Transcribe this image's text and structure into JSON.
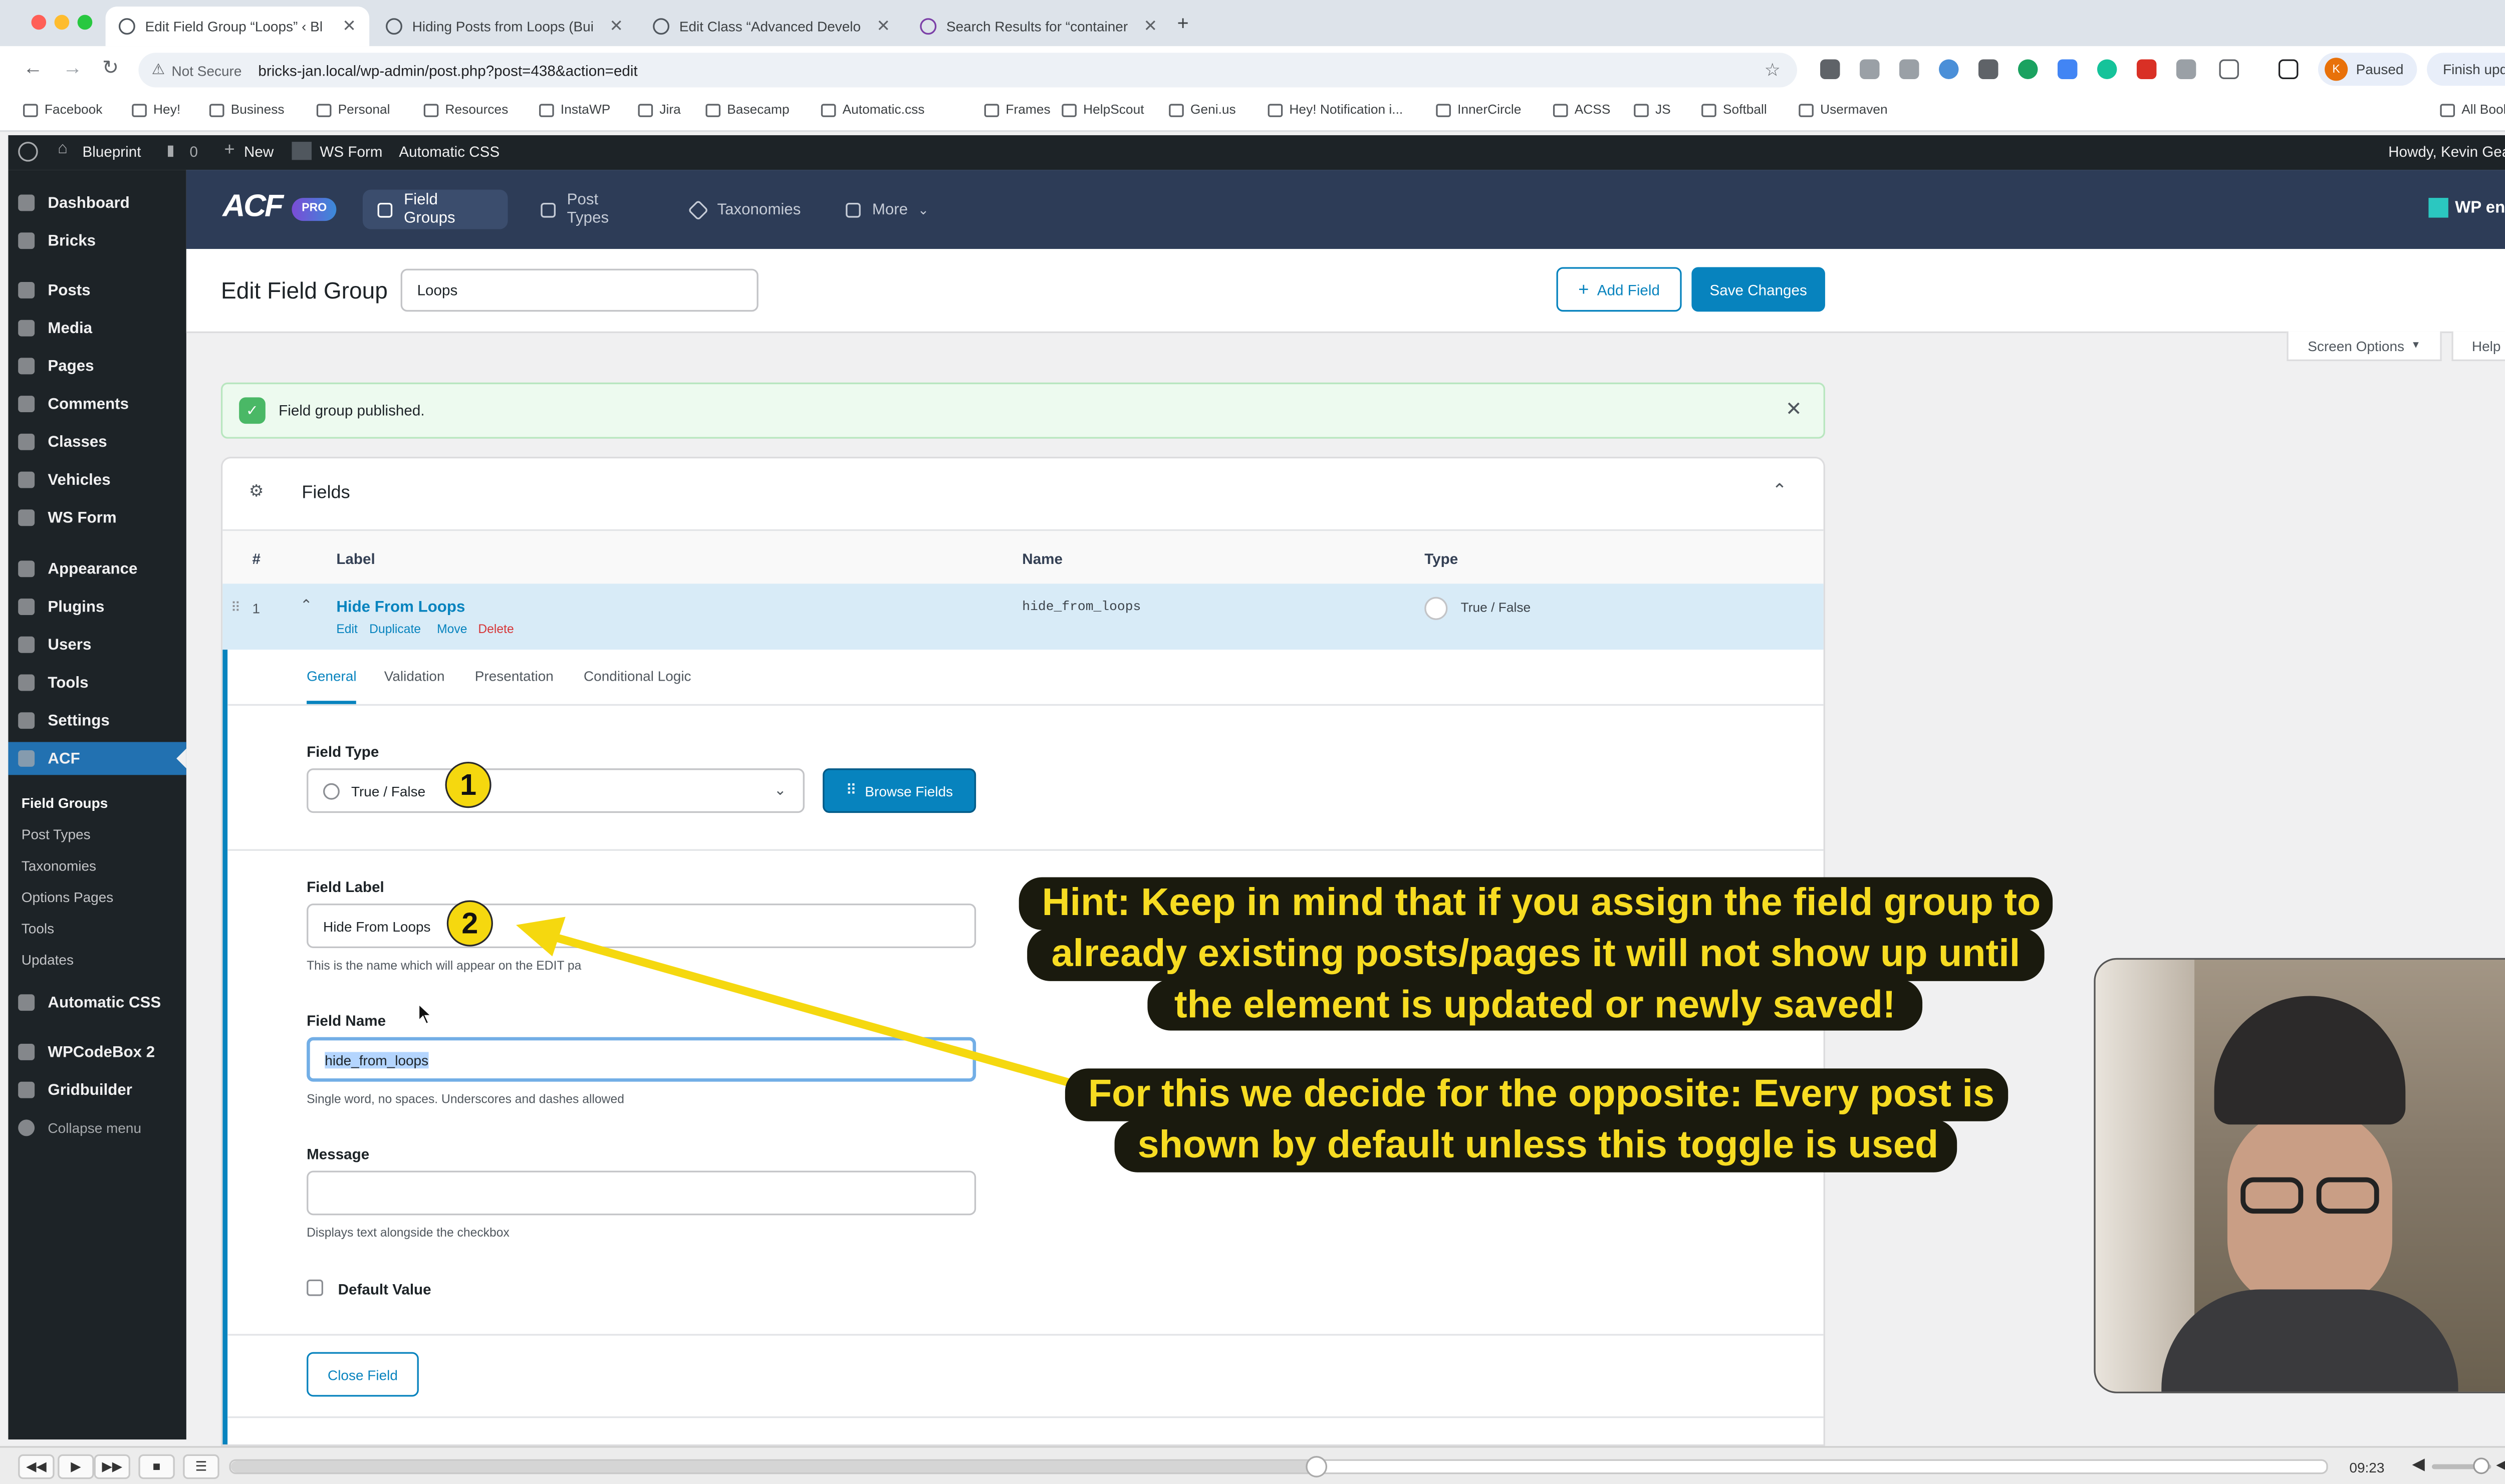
{
  "browser": {
    "tabs": [
      {
        "title": "Edit Field Group “Loops” ‹ Bl"
      },
      {
        "title": "Hiding Posts from Loops (Bui"
      },
      {
        "title": "Edit Class “Advanced Develo"
      },
      {
        "title": "Search Results for “container"
      }
    ],
    "new_tab": "+",
    "security_label": "Not Secure",
    "url": "bricks-jan.local/wp-admin/post.php?post=438&action=edit",
    "profile_initial": "K",
    "profile_status": "Paused",
    "finish_update": "Finish update",
    "bookmarks": [
      "Facebook",
      "Hey!",
      "Business",
      "Personal",
      "Resources",
      "InstaWP",
      "Jira",
      "Basecamp",
      "Automatic.css",
      "Frames",
      "HelpScout",
      "Geni.us",
      "Hey! Notification i...",
      "InnerCircle",
      "ACSS",
      "JS",
      "Softball",
      "Usermaven"
    ],
    "all_bookmarks": "All Bookmarks"
  },
  "admin_bar": {
    "site_name": "Blueprint",
    "comments": "0",
    "new": "New",
    "ws_form": "WS Form",
    "automatic_css": "Automatic CSS",
    "howdy": "Howdy, Kevin Geary"
  },
  "sidebar": {
    "items": [
      "Dashboard",
      "Bricks",
      "Posts",
      "Media",
      "Pages",
      "Comments",
      "Classes",
      "Vehicles",
      "WS Form",
      "Appearance",
      "Plugins",
      "Users",
      "Tools",
      "Settings",
      "ACF"
    ],
    "acf_sub": [
      "Field Groups",
      "Post Types",
      "Taxonomies",
      "Options Pages",
      "Tools",
      "Updates"
    ],
    "lower": [
      "Automatic CSS",
      "WPCodeBox 2",
      "Gridbuilder"
    ],
    "collapse": "Collapse menu"
  },
  "acf_nav": {
    "logo": "ACF",
    "pro": "PRO",
    "tabs": [
      "Field Groups",
      "Post Types",
      "Taxonomies",
      "More"
    ],
    "host": "WP engine"
  },
  "header": {
    "title": "Edit Field Group",
    "group_name": "Loops",
    "add_field": "Add Field",
    "save_changes": "Save Changes",
    "screen_options": "Screen Options",
    "help": "Help"
  },
  "notice": {
    "text": "Field group published."
  },
  "fields": {
    "title": "Fields",
    "columns": [
      "#",
      "Label",
      "Name",
      "Type"
    ],
    "row": {
      "num": "1",
      "label": "Hide From Loops",
      "actions": [
        "Edit",
        "Duplicate",
        "Move",
        "Delete"
      ],
      "name": "hide_from_loops",
      "type": "True / False"
    },
    "tabs": [
      "General",
      "Validation",
      "Presentation",
      "Conditional Logic"
    ],
    "field_type_label": "Field Type",
    "field_type_value": "True / False",
    "browse_fields": "Browse Fields",
    "field_label_label": "Field Label",
    "field_label_value": "Hide From Loops",
    "field_label_help": "This is the name which will appear on the EDIT pa",
    "field_name_label": "Field Name",
    "field_name_value": "hide_from_loops",
    "field_name_help": "Single word, no spaces. Underscores and dashes allowed",
    "message_label": "Message",
    "message_help": "Displays text alongside the checkbox",
    "default_value_label": "Default Value",
    "close_field": "Close Field"
  },
  "overlay": {
    "badge1": "1",
    "badge2": "2",
    "hint_lines": [
      "Hint: Keep in mind that if you assign the field group to",
      "already existing posts/pages it will not show up until",
      "the element is updated or newly saved!"
    ],
    "note_lines": [
      "For this we decide for the opposite: Every post is",
      "shown by default unless this toggle is used"
    ],
    "accent": "#f5d80f"
  },
  "video": {
    "time": "09:23",
    "progress": 0.518
  }
}
